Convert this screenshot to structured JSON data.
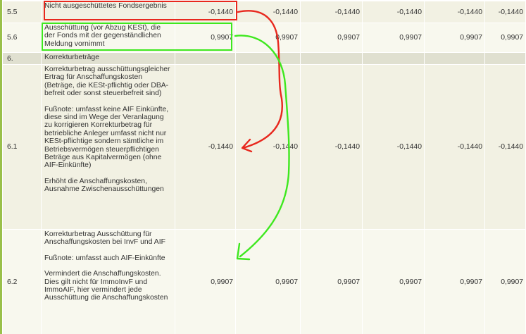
{
  "rows": [
    {
      "num": "5.5",
      "desc": [
        "Nicht ausgeschüttetes Fondsergebnis"
      ],
      "values": [
        "-0,1440",
        "-0,1440",
        "-0,1440",
        "-0,1440",
        "-0,1440",
        "-0,1440"
      ]
    },
    {
      "num": "5.6",
      "desc": [
        "Ausschüttung (vor Abzug KESt), die der Fonds mit der gegenständlichen Meldung vornimmt"
      ],
      "values": [
        "0,9907",
        "0,9907",
        "0,9907",
        "0,9907",
        "0,9907",
        "0,9907"
      ]
    },
    {
      "num": "6.",
      "desc": [
        "Korrekturbeträge"
      ],
      "values": [
        "",
        "",
        "",
        "",
        "",
        ""
      ]
    },
    {
      "num": "6.1",
      "desc": [
        "Korrekturbetrag ausschüttungsgleicher Ertrag für Anschaffungskosten (Beträge, die KESt-pflichtig oder DBA-befreit oder sonst steuerbefreit sind)",
        "Fußnote: umfasst keine AIF Einkünfte, diese sind im Wege der Veranlagung zu korrigieren Korrekturbetrag für betriebliche Anleger umfasst nicht nur KESt-pflichtige sondern sämtliche im Betriebsvermögen steuerpflichtigen Beträge aus Kapitalvermögen (ohne AIF-Einkünfte)",
        "Erhöht die Anschaffungskosten, Ausnahme Zwischenausschüttungen"
      ],
      "values": [
        "-0,1440",
        "-0,1440",
        "-0,1440",
        "-0,1440",
        "-0,1440",
        "-0,1440"
      ]
    },
    {
      "num": "6.2",
      "desc": [
        "Korrekturbetrag Ausschüttung für Anschaffungskosten bei InvF und AIF",
        "Fußnote: umfasst auch AIF-Einkünfte",
        "Vermindert die Anschaffungskosten. Dies gilt nicht für ImmoInvF und ImmoAIF, hier vermindert jede Ausschüttung die Anschaffungskosten"
      ],
      "values": [
        "0,9907",
        "0,9907",
        "0,9907",
        "0,9907",
        "0,9907",
        "0,9907"
      ]
    }
  ],
  "annotations": {
    "red_color": "#e8281e",
    "green_color": "#3ee81e"
  }
}
